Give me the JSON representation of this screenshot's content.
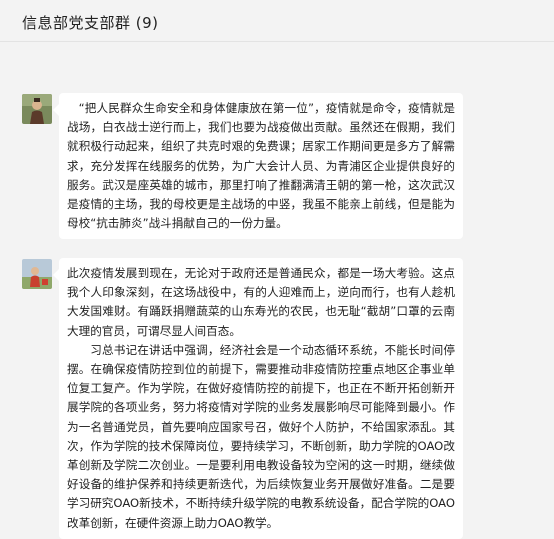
{
  "header": {
    "title": "信息部党支部群 (9)"
  },
  "messages": [
    {
      "avatar": "user-avatar-photo",
      "paragraphs": [
        "“把人民群众生命安全和身体健康放在第一位”，疫情就是命令，疫情就是战场，白衣战士逆行而上，我们也要为战疫做出贡献。虽然还在假期，我们就积极行动起来，组织了共克时艰的免费课；居家工作期间更是多方了解需求，充分发挥在线服务的优势，为广大会计人员、为青浦区企业提供良好的服务。武汉是座英雄的城市，那里打响了推翻满清王朝的第一枪，这次武汉是疫情的主场，我的母校更是主战场的中竖，我虽不能亲上前线，但是能为母校“抗击肺炎”战斗捐献自己的一份力量。"
      ]
    },
    {
      "avatar": "user-avatar-photo",
      "paragraphs": [
        "此次疫情发展到现在，无论对于政府还是普通民众，都是一场大考验。这点我个人印象深刻，在这场战役中，有的人迎难而上，逆向而行，也有人趁机大发国难财。有踊跃捐赠蔬菜的山东寿光的农民，也无耻“截胡”口罩的云南大理的官员，可谓尽显人间百态。",
        "习总书记在讲话中强调，经济社会是一个动态循环系统，不能长时间停摆。在确保疫情防控到位的前提下，需要推动非疫情防控重点地区企事业单位复工复产。作为学院，在做好疫情防控的前提下，也正在不断开拓创新开展学院的各项业务，努力将疫情对学院的业务发展影响尽可能降到最小。作为一名普通党员，首先要响应国家号召，做好个人防护，不给国家添乱。其次，作为学院的技术保障岗位，要持续学习，不断创新，助力学院的OAO改革创新及学院二次创业。一是要利用电教设备较为空闲的这一时期，继续做好设备的维护保养和持续更新迭代，为后续恢复业务开展做好准备。二是要学习研究OAO新技术，不断持续升级学院的电教系统设备，配合学院的OAO改革创新，在硬件资源上助力OAO教学。"
      ]
    }
  ]
}
